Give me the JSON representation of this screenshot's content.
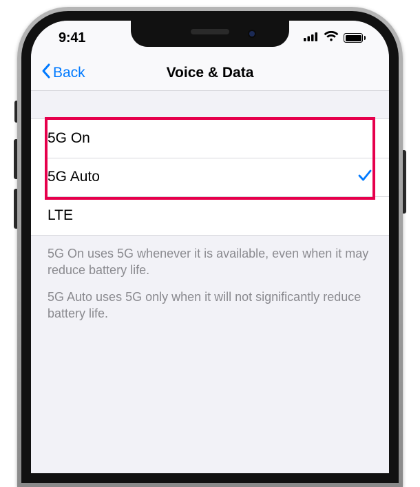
{
  "status": {
    "time": "9:41"
  },
  "nav": {
    "back_label": "Back",
    "title": "Voice & Data"
  },
  "options": {
    "item0": {
      "label": "5G On",
      "selected": false
    },
    "item1": {
      "label": "5G Auto",
      "selected": true
    },
    "item2": {
      "label": "LTE",
      "selected": false
    }
  },
  "footer": {
    "p1": "5G On uses 5G whenever it is available, even when it may reduce battery life.",
    "p2": "5G Auto uses 5G only when it will not significantly reduce battery life."
  },
  "colors": {
    "tint": "#007aff",
    "highlight": "#e6004c"
  }
}
